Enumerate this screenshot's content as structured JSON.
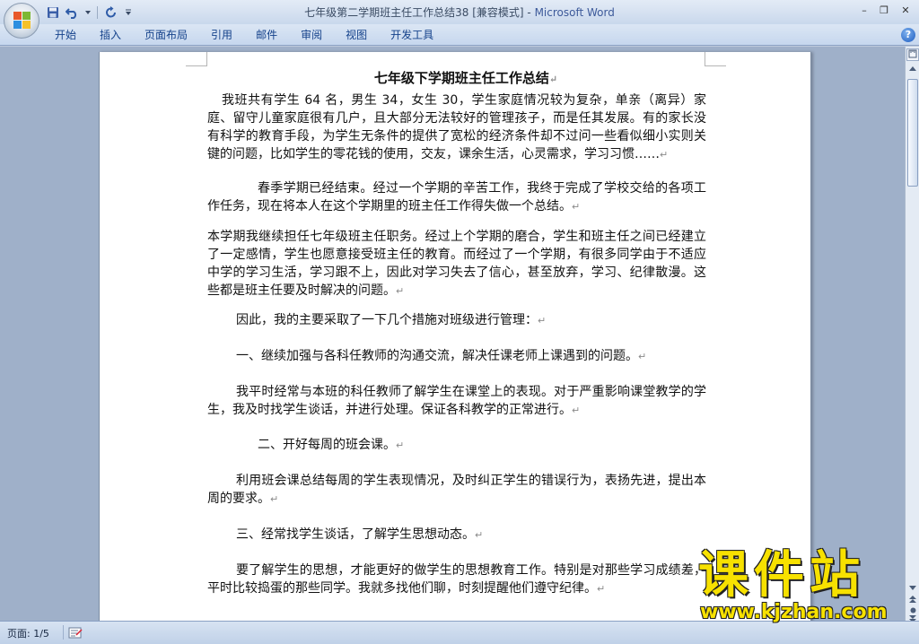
{
  "window": {
    "title": "七年级第二学期班主任工作总结38 [兼容模式] - ",
    "app_name": "Microsoft Word"
  },
  "ribbon": {
    "tabs": [
      {
        "label": "开始"
      },
      {
        "label": "插入"
      },
      {
        "label": "页面布局"
      },
      {
        "label": "引用"
      },
      {
        "label": "邮件"
      },
      {
        "label": "审阅"
      },
      {
        "label": "视图"
      },
      {
        "label": "开发工具"
      }
    ],
    "help": "?"
  },
  "window_controls": {
    "minimize": "–",
    "maximize": "❐",
    "close": "✕"
  },
  "document": {
    "title": "七年级下学期班主任工作总结",
    "paragraphs": [
      {
        "text": "我班共有学生 64 名，男生 34，女生 30，学生家庭情况较为复杂，单亲（离异）家庭、留守儿童家庭很有几户，且大部分无法较好的管理孩子，而是任其发展。有的家长没有科学的教育手段，为学生无条件的提供了宽松的经济条件却不过问一些看似细小实则关键的问题，比如学生的零花钱的使用，交友，课余生活，心灵需求，学习习惯……"
      },
      {
        "text": "春季学期已经结束。经过一个学期的辛苦工作，我终于完成了学校交给的各项工作任务，现在将本人在这个学期里的班主任工作得失做一个总结。"
      },
      {
        "text": "本学期我继续担任七年级班主任职务。经过上个学期的磨合，学生和班主任之间已经建立了一定感情，学生也愿意接受班主任的教育。而经过了一个学期，有很多同学由于不适应中学的学习生活，学习跟不上，因此对学习失去了信心，甚至放弃，学习、纪律散漫。这些都是班主任要及时解决的问题。"
      },
      {
        "text": "因此，我的主要采取了一下几个措施对班级进行管理："
      },
      {
        "text": "一、继续加强与各科任教师的沟通交流，解决任课老师上课遇到的问题。"
      },
      {
        "text": "我平时经常与本班的科任教师了解学生在课堂上的表现。对于严重影响课堂教学的学生，我及时找学生谈话，并进行处理。保证各科教学的正常进行。"
      },
      {
        "text": "二、开好每周的班会课。"
      },
      {
        "text": "利用班会课总结每周的学生表现情况，及时纠正学生的错误行为，表扬先进，提出本周的要求。"
      },
      {
        "text": "三、经常找学生谈话，了解学生思想动态。"
      },
      {
        "text": "要了解学生的思想，才能更好的做学生的思想教育工作。特别是对那些学习成绩差，平时比较捣蛋的那些同学。我就多找他们聊，时刻提醒他们遵守纪律。"
      }
    ],
    "paragraph_mark": "↵"
  },
  "status": {
    "page": "页面: 1/5"
  },
  "watermark": {
    "cn": "课件站",
    "en": "www.kjzhan.com"
  },
  "colors": {
    "ribbon_text": "#15428b",
    "workspace": "#9fb0c9",
    "watermark": "#f7e100"
  }
}
